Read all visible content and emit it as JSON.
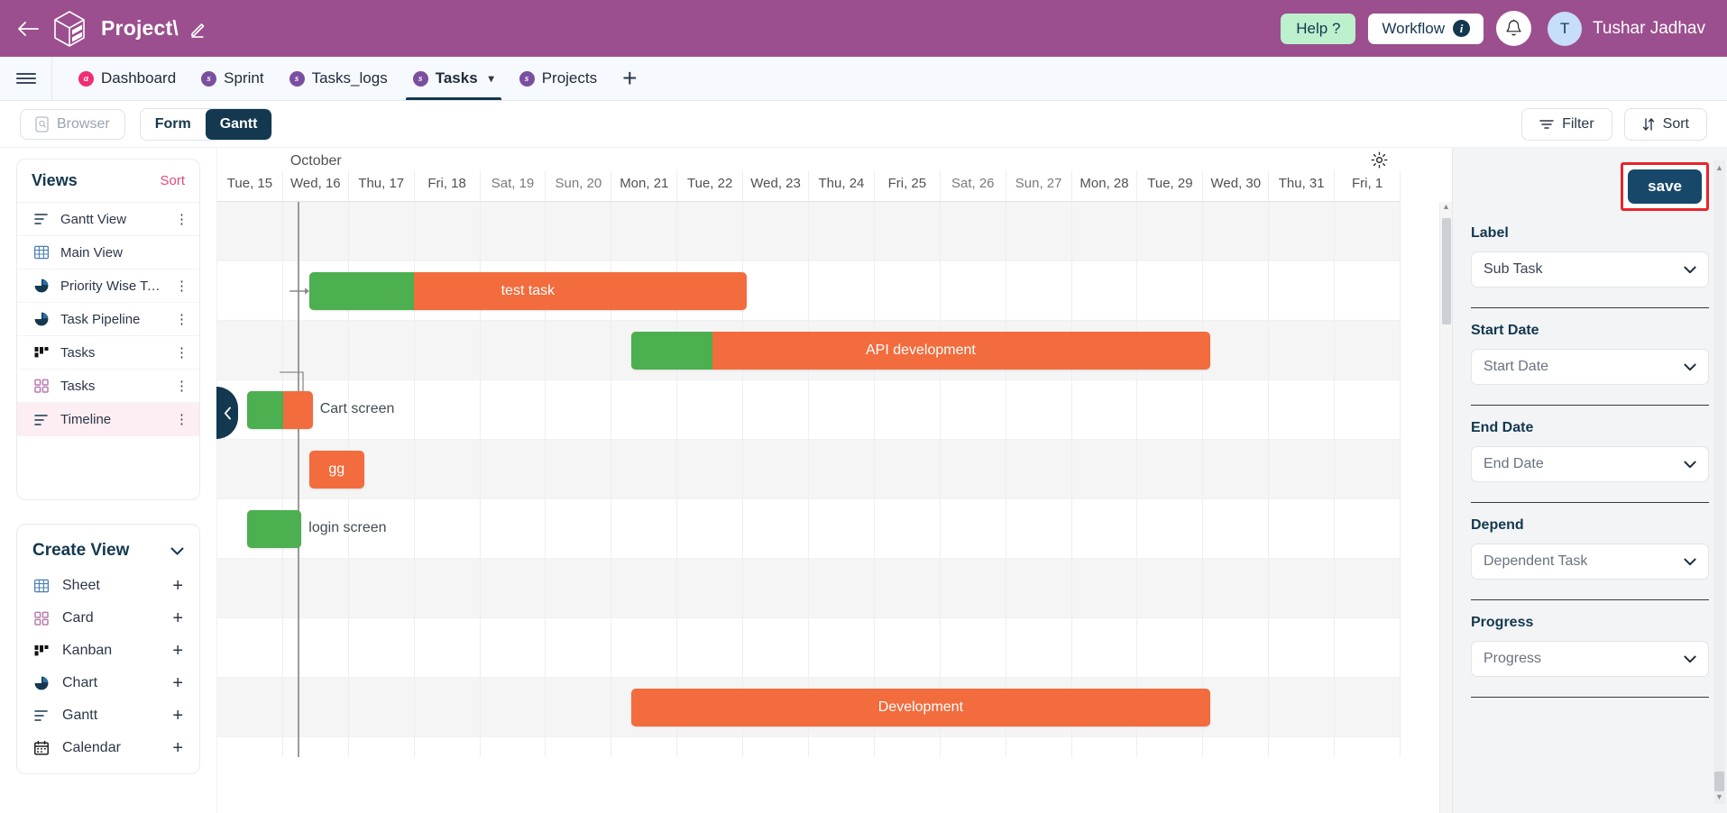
{
  "topbar": {
    "back_icon": "arrow-left-icon",
    "logo_icon": "cube-logo-icon",
    "project_title": "Project\\",
    "edit_icon": "pencil-icon",
    "help_label": "Help ?",
    "workflow_label": "Workflow",
    "workflow_info_icon": "info-icon",
    "bell_icon": "bell-icon",
    "avatar_initial": "T",
    "user_name": "Tushar Jadhav",
    "bg_color": "#9b4f8e",
    "help_bg_color": "#bdf0cd"
  },
  "tabbar": {
    "menu_icon": "hamburger-icon",
    "add_tab_label": "+",
    "tabs": [
      {
        "label": "Dashboard",
        "badge": "a",
        "badge_color": "#ef2e73",
        "active": false
      },
      {
        "label": "Sprint",
        "badge": "s",
        "badge_color": "#7b4fa0",
        "active": false
      },
      {
        "label": "Tasks_logs",
        "badge": "s",
        "badge_color": "#7b4fa0",
        "active": false
      },
      {
        "label": "Tasks",
        "badge": "s",
        "badge_color": "#7b4fa0",
        "active": true
      },
      {
        "label": "Projects",
        "badge": "s",
        "badge_color": "#7b4fa0",
        "active": false
      }
    ]
  },
  "toolbar": {
    "browser_label": "Browser",
    "browser_icon": "browser-icon",
    "form_label": "Form",
    "gantt_label": "Gantt",
    "active_segment": "Gantt",
    "filter_label": "Filter",
    "filter_icon": "filter-icon",
    "sort_label": "Sort",
    "sort_icon": "sort-icon"
  },
  "sidebar": {
    "views_title": "Views",
    "views_sort_label": "Sort",
    "views": [
      {
        "label": "Gantt View",
        "icon": "gantt-icon",
        "kebab": true,
        "selected": false
      },
      {
        "label": "Main View",
        "icon": "sheet-icon",
        "kebab": false,
        "selected": false
      },
      {
        "label": "Priority Wise Ta…",
        "icon": "chart-icon",
        "kebab": true,
        "selected": false
      },
      {
        "label": "Task Pipeline",
        "icon": "chart-icon",
        "kebab": true,
        "selected": false
      },
      {
        "label": "Tasks",
        "icon": "kanban-icon",
        "kebab": true,
        "selected": false
      },
      {
        "label": "Tasks",
        "icon": "card-icon",
        "kebab": true,
        "selected": false
      },
      {
        "label": "Timeline",
        "icon": "gantt-icon",
        "kebab": true,
        "selected": true
      }
    ],
    "create_title": "Create View",
    "create_caret_icon": "chevron-down-icon",
    "create_items": [
      {
        "label": "Sheet",
        "icon": "sheet-icon",
        "add": "+"
      },
      {
        "label": "Card",
        "icon": "card-icon",
        "add": "+"
      },
      {
        "label": "Kanban",
        "icon": "kanban-icon",
        "add": "+"
      },
      {
        "label": "Chart",
        "icon": "chart-icon",
        "add": "+"
      },
      {
        "label": "Gantt",
        "icon": "gantt-icon",
        "add": "+"
      },
      {
        "label": "Calendar",
        "icon": "calendar-icon",
        "add": "+"
      }
    ]
  },
  "gantt": {
    "collapse_icon": "chevron-left-icon",
    "settings_icon": "gear-icon",
    "month_label": "October",
    "month_col_index": 1,
    "days": [
      {
        "label": "Tue, 15",
        "weekend": false
      },
      {
        "label": "Wed, 16",
        "weekend": false
      },
      {
        "label": "Thu, 17",
        "weekend": false
      },
      {
        "label": "Fri, 18",
        "weekend": false
      },
      {
        "label": "Sat, 19",
        "weekend": true
      },
      {
        "label": "Sun, 20",
        "weekend": true
      },
      {
        "label": "Mon, 21",
        "weekend": false
      },
      {
        "label": "Tue, 22",
        "weekend": false
      },
      {
        "label": "Wed, 23",
        "weekend": false
      },
      {
        "label": "Thu, 24",
        "weekend": false
      },
      {
        "label": "Fri, 25",
        "weekend": false
      },
      {
        "label": "Sat, 26",
        "weekend": true
      },
      {
        "label": "Sun, 27",
        "weekend": true
      },
      {
        "label": "Mon, 28",
        "weekend": false
      },
      {
        "label": "Tue, 29",
        "weekend": false
      },
      {
        "label": "Wed, 30",
        "weekend": false
      },
      {
        "label": "Thu, 31",
        "weekend": false
      },
      {
        "label": "Fri, 1",
        "weekend": false
      }
    ],
    "bar_color": "#f26c3d",
    "progress_color": "#4caf50",
    "today_marker_day_offset": 0.22,
    "rows": 9,
    "tasks": [
      {
        "name": "test task",
        "row": 1,
        "start_day": 0.4,
        "span_days": 6.65,
        "progress_pct": 24,
        "label_inside": true,
        "has_dep_arrow_in": true
      },
      {
        "name": "API development",
        "row": 2,
        "start_day": 5.3,
        "span_days": 8.8,
        "progress_pct": 14,
        "label_inside": true,
        "has_dep_arrow_in": false
      },
      {
        "name": "Cart screen",
        "row": 3,
        "start_day": -0.55,
        "span_days": 1.0,
        "progress_pct": 55,
        "label_inside": false,
        "has_dep_arrow_in": false
      },
      {
        "name": "gg",
        "row": 4,
        "start_day": 0.4,
        "span_days": 0.83,
        "progress_pct": 0,
        "label_inside": true,
        "has_dep_arrow_in": false
      },
      {
        "name": "login screen",
        "row": 5,
        "start_day": -0.55,
        "span_days": 0.83,
        "progress_pct": 100,
        "label_inside": false,
        "has_dep_arrow_in": false
      },
      {
        "name": "Development",
        "row": 8,
        "start_day": 5.3,
        "span_days": 8.8,
        "progress_pct": 0,
        "label_inside": true,
        "has_dep_arrow_in": false
      }
    ]
  },
  "right_panel": {
    "save_label": "save",
    "save_highlight_color": "#e8252b",
    "fields": [
      {
        "label": "Label",
        "value": "Sub Task",
        "is_placeholder": false,
        "caret_icon": "chevron-down-icon"
      },
      {
        "label": "Start Date",
        "value": "Start Date",
        "is_placeholder": true,
        "caret_icon": "chevron-down-icon"
      },
      {
        "label": "End Date",
        "value": "End Date",
        "is_placeholder": true,
        "caret_icon": "chevron-down-icon"
      },
      {
        "label": "Depend",
        "value": "Dependent Task",
        "is_placeholder": true,
        "caret_icon": "chevron-down-icon"
      },
      {
        "label": "Progress",
        "value": "Progress",
        "is_placeholder": true,
        "caret_icon": "chevron-down-icon"
      }
    ]
  }
}
